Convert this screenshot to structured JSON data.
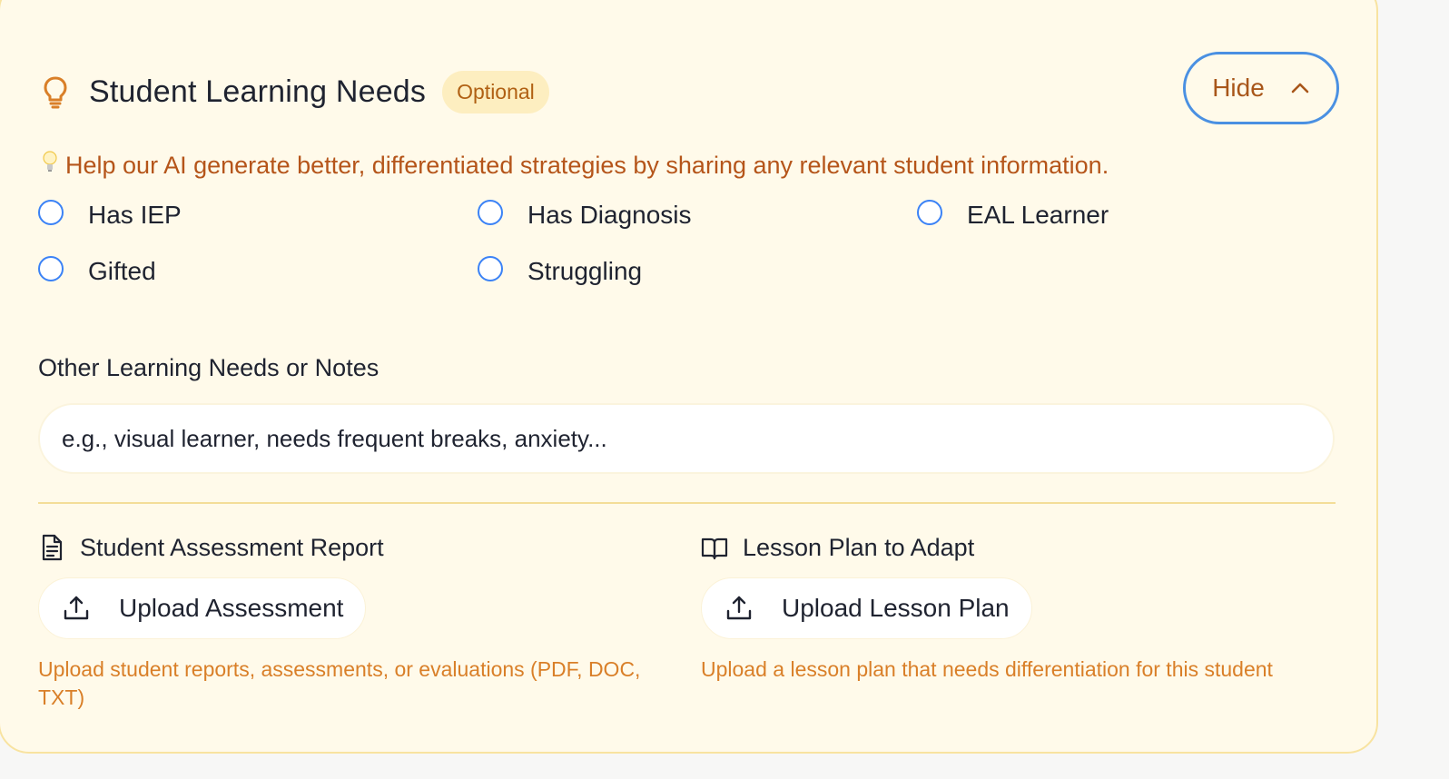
{
  "section": {
    "title": "Student Learning Needs",
    "badge": "Optional",
    "toggle_label": "Hide",
    "hint": "Help our AI generate better, differentiated strategies by sharing any relevant student information."
  },
  "checkboxes": [
    {
      "label": "Has IEP",
      "checked": false
    },
    {
      "label": "Has Diagnosis",
      "checked": false
    },
    {
      "label": "EAL Learner",
      "checked": false
    },
    {
      "label": "Gifted",
      "checked": false
    },
    {
      "label": "Struggling",
      "checked": false
    }
  ],
  "notes": {
    "label": "Other Learning Needs or Notes",
    "placeholder": "e.g., visual learner, needs frequent breaks, anxiety...",
    "value": ""
  },
  "uploads": {
    "assessment": {
      "title": "Student Assessment Report",
      "button": "Upload Assessment",
      "help": "Upload student reports, assessments, or evaluations (PDF, DOC, TXT)"
    },
    "lesson_plan": {
      "title": "Lesson Plan to Adapt",
      "button": "Upload Lesson Plan",
      "help": "Upload a lesson plan that needs differentiation for this student"
    }
  },
  "colors": {
    "card_background": "#fffaea",
    "card_border": "#f8e3a0",
    "accent_orange": "#b5551a",
    "focus_blue": "#4a90e2",
    "radio_blue": "#3b82f6"
  },
  "icons": {
    "header": "lightbulb-icon",
    "hint": "lightbulb-emoji-icon",
    "toggle": "chevron-up-icon",
    "assessment": "file-text-icon",
    "lesson_plan": "book-open-icon",
    "upload": "upload-icon"
  }
}
